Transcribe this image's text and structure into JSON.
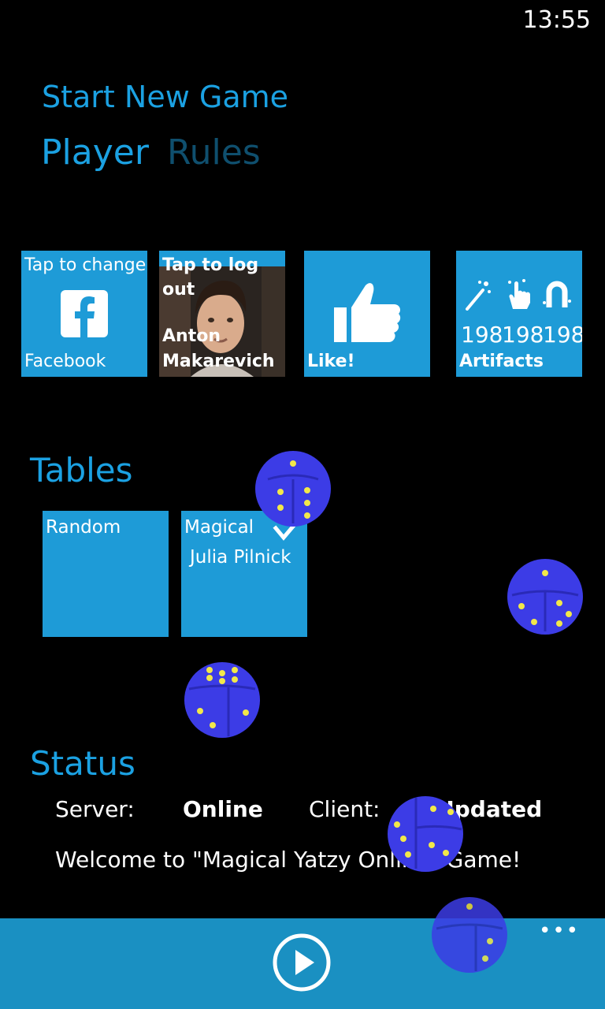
{
  "status_bar": {
    "time": "13:55"
  },
  "app_title": "Start New Game",
  "pivot": {
    "items": [
      "Player",
      "Rules"
    ],
    "selected": "Player"
  },
  "tiles": {
    "facebook": {
      "top_label": "Tap to change",
      "bottom_label": "Facebook",
      "icon": "facebook-icon"
    },
    "profile": {
      "top_label_1": "Tap to log",
      "top_label_2": "out",
      "name_1": "Anton",
      "name_2": "Makarevich"
    },
    "like": {
      "label": "Like!",
      "icon": "thumbs-up-icon"
    },
    "artifacts": {
      "counts": [
        "198",
        "198",
        "198"
      ],
      "label": "Artifacts",
      "icons": [
        "magic-wand-icon",
        "tap-hand-icon",
        "magnet-icon"
      ]
    }
  },
  "tables": {
    "heading": "Tables",
    "items": [
      {
        "label": "Random",
        "selected": false
      },
      {
        "label": "Magical",
        "subtitle": "Julia Pilnick",
        "selected": true
      }
    ]
  },
  "status": {
    "heading": "Status",
    "server_label": "Server:",
    "server_value": "Online",
    "client_label": "Client:",
    "client_value": "Updated",
    "welcome": "Welcome to \"Magical Yatzy Online\" Game!"
  },
  "app_bar": {
    "play_icon": "play-icon",
    "more": "•••"
  },
  "colors": {
    "accent": "#1ba1e2",
    "tile": "#1e9bd7",
    "app_bar": "#1a90c2",
    "dice": "#3c3ce6",
    "pips": "#f2e84a"
  }
}
